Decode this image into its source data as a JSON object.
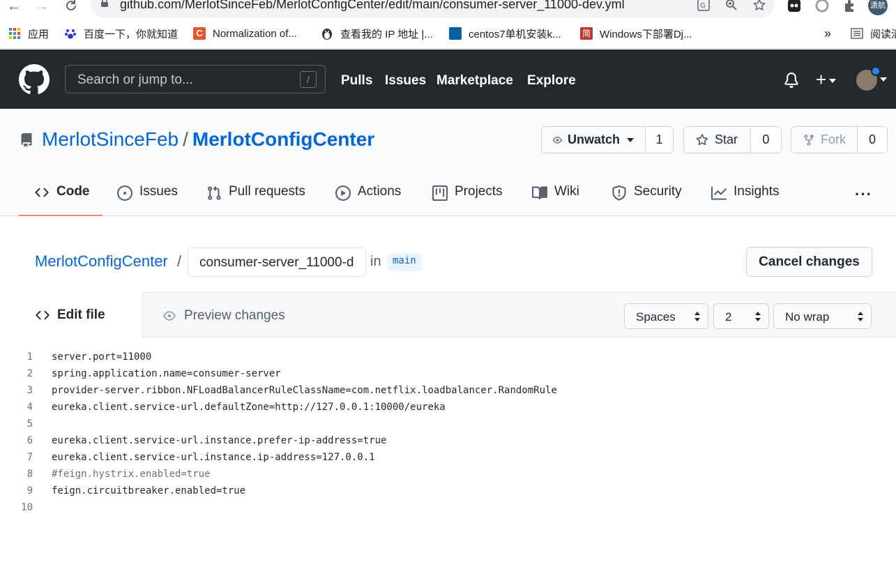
{
  "browser": {
    "url": "github.com/MerlotSinceFeb/MerlotConfigCenter/edit/main/consumer-server_11000-dev.yml",
    "bookmarks": [
      {
        "label": "应用",
        "color": "#4285f4"
      },
      {
        "label": "百度一下，你就知道",
        "color": "#2932e1"
      },
      {
        "label": "Normalization of...",
        "color": "#e8562a"
      },
      {
        "label": "查看我的 IP 地址 |...",
        "color": "#333333"
      },
      {
        "label": "centos7单机安装k...",
        "color": "#0b5fa5"
      },
      {
        "label": "Windows下部署Dj...",
        "color": "#c0392b"
      }
    ],
    "bookmarks_overflow": "»",
    "reading_list": "阅读清",
    "profile_label": "潇航"
  },
  "github": {
    "search_placeholder": "Search or jump to...",
    "search_key": "/",
    "nav": [
      "Pulls",
      "Issues",
      "Marketplace",
      "Explore"
    ],
    "plus": "+"
  },
  "repo": {
    "owner": "MerlotSinceFeb",
    "separator": "/",
    "name": "MerlotConfigCenter",
    "unwatch_label": "Unwatch",
    "watch_count": "1",
    "star_label": "Star",
    "star_count": "0",
    "fork_label": "Fork",
    "fork_count": "0",
    "tabs": {
      "code": "Code",
      "issues": "Issues",
      "pulls": "Pull requests",
      "actions": "Actions",
      "projects": "Projects",
      "wiki": "Wiki",
      "security": "Security",
      "insights": "Insights"
    },
    "more": "···"
  },
  "editor": {
    "breadcrumb_repo": "MerlotConfigCenter",
    "breadcrumb_sep": "/",
    "filename": "consumer-server_11000-d",
    "in_label": "in",
    "branch": "main",
    "cancel_label": "Cancel changes",
    "tab_edit": "Edit file",
    "tab_preview": "Preview changes",
    "indent_mode": "Spaces",
    "indent_size": "2",
    "wrap_mode": "No wrap",
    "lines": [
      {
        "n": "1",
        "text": "server.port=11000",
        "comment": false
      },
      {
        "n": "2",
        "text": "spring.application.name=consumer-server",
        "comment": false
      },
      {
        "n": "3",
        "text": "provider-server.ribbon.NFLoadBalancerRuleClassName=com.netflix.loadbalancer.RandomRule",
        "comment": false
      },
      {
        "n": "4",
        "text": "eureka.client.service-url.defaultZone=http://127.0.0.1:10000/eureka",
        "comment": false
      },
      {
        "n": "5",
        "text": "",
        "comment": false
      },
      {
        "n": "6",
        "text": "eureka.client.service-url.instance.prefer-ip-address=true",
        "comment": false
      },
      {
        "n": "7",
        "text": "eureka.client.service-url.instance.ip-address=127.0.0.1",
        "comment": false
      },
      {
        "n": "8",
        "text": "#feign.hystrix.enabled=true",
        "comment": true
      },
      {
        "n": "9",
        "text": "feign.circuitbreaker.enabled=true",
        "comment": false
      },
      {
        "n": "10",
        "text": "",
        "comment": false
      }
    ]
  }
}
